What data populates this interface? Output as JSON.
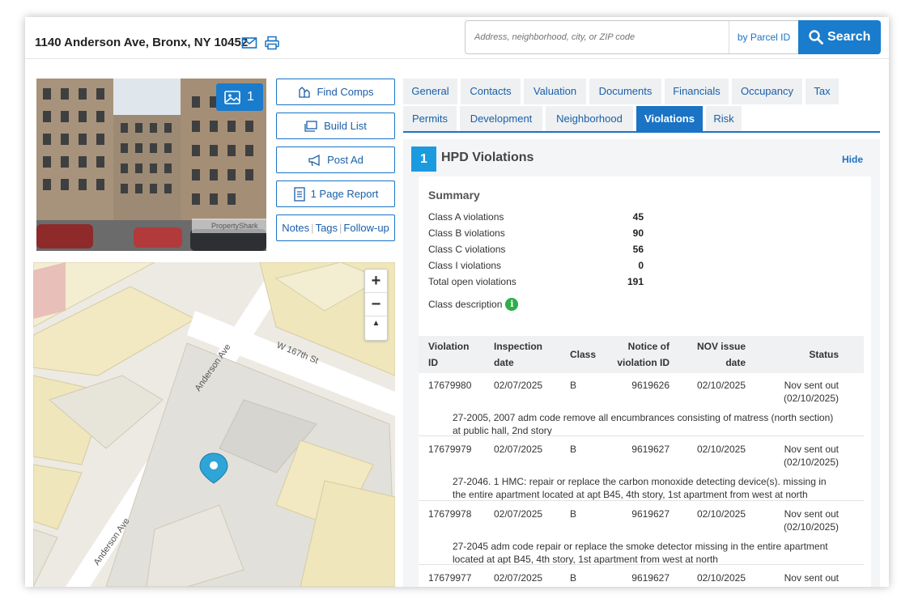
{
  "header": {
    "address": "1140 Anderson Ave, Bronx, NY 10452",
    "email_icon": "envelope-icon",
    "print_icon": "printer-icon",
    "search_placeholder": "Address, neighborhood, city, or ZIP code",
    "parcel_label": "by Parcel ID",
    "search_label": "Search"
  },
  "photo": {
    "count": "1",
    "watermark": "PropertyShark"
  },
  "actions": {
    "find_comps": "Find Comps",
    "build_list": "Build List",
    "post_ad": "Post Ad",
    "page_report": "1 Page Report",
    "notes": "Notes",
    "tags": "Tags",
    "follow_up": "Follow-up"
  },
  "map": {
    "street1": "Anderson Ave",
    "street2": "W 167th St",
    "street3": "Anderson Ave",
    "zoom_in": "+",
    "zoom_out": "−",
    "compass": "▲"
  },
  "tabs": {
    "row1": [
      "General",
      "Contacts",
      "Valuation",
      "Documents",
      "Financials",
      "Occupancy",
      "Tax"
    ],
    "row2": [
      "Permits",
      "Development",
      "Neighborhood",
      "Violations",
      "Risk"
    ],
    "active": "Violations"
  },
  "panel": {
    "number": "1",
    "title": "HPD Violations",
    "hide_label": "Hide"
  },
  "summary": {
    "title": "Summary",
    "rows": [
      {
        "label": "Class A violations",
        "value": "45"
      },
      {
        "label": "Class B violations",
        "value": "90"
      },
      {
        "label": "Class C violations",
        "value": "56"
      },
      {
        "label": "Class I violations",
        "value": "0"
      },
      {
        "label": "Total open violations",
        "value": "191"
      }
    ],
    "class_description": "Class description"
  },
  "table": {
    "headers": {
      "violation_id_1": "Violation",
      "violation_id_2": "ID",
      "inspection_1": "Inspection",
      "inspection_2": "date",
      "class": "Class",
      "notice_1": "Notice of",
      "notice_2": "violation ID",
      "nov_1": "NOV issue",
      "nov_2": "date",
      "status": "Status"
    },
    "rows": [
      {
        "violation_id": "17679980",
        "inspection_date": "02/07/2025",
        "class": "B",
        "notice_id": "9619626",
        "nov_date": "02/10/2025",
        "status_1": "Nov sent out",
        "status_2": "(02/10/2025)",
        "desc_1": "27-2005, 2007 adm code remove all encumbrances consisting of matress (north section)",
        "desc_2": "at public hall, 2nd story"
      },
      {
        "violation_id": "17679979",
        "inspection_date": "02/07/2025",
        "class": "B",
        "notice_id": "9619627",
        "nov_date": "02/10/2025",
        "status_1": "Nov sent out",
        "status_2": "(02/10/2025)",
        "desc_1": "27-2046. 1 HMC: repair or replace the carbon monoxide detecting device(s). missing in",
        "desc_2": "the entire apartment located at apt B45, 4th story, 1st apartment from west at north"
      },
      {
        "violation_id": "17679978",
        "inspection_date": "02/07/2025",
        "class": "B",
        "notice_id": "9619627",
        "nov_date": "02/10/2025",
        "status_1": "Nov sent out",
        "status_2": "(02/10/2025)",
        "desc_1": "27-2045 adm code repair or replace the smoke detector missing in the entire apartment",
        "desc_2": "located at apt B45, 4th story, 1st apartment from west at north"
      },
      {
        "violation_id": "17679977",
        "inspection_date": "02/07/2025",
        "class": "B",
        "notice_id": "9619627",
        "nov_date": "02/10/2025",
        "status_1": "Nov sent out",
        "status_2": "",
        "desc_1": "",
        "desc_2": ""
      }
    ]
  },
  "colors": {
    "accent": "#1a73c4",
    "tab_bg": "#eef0f2",
    "number_badge": "#1a9be0",
    "info_green": "#2cae48"
  }
}
